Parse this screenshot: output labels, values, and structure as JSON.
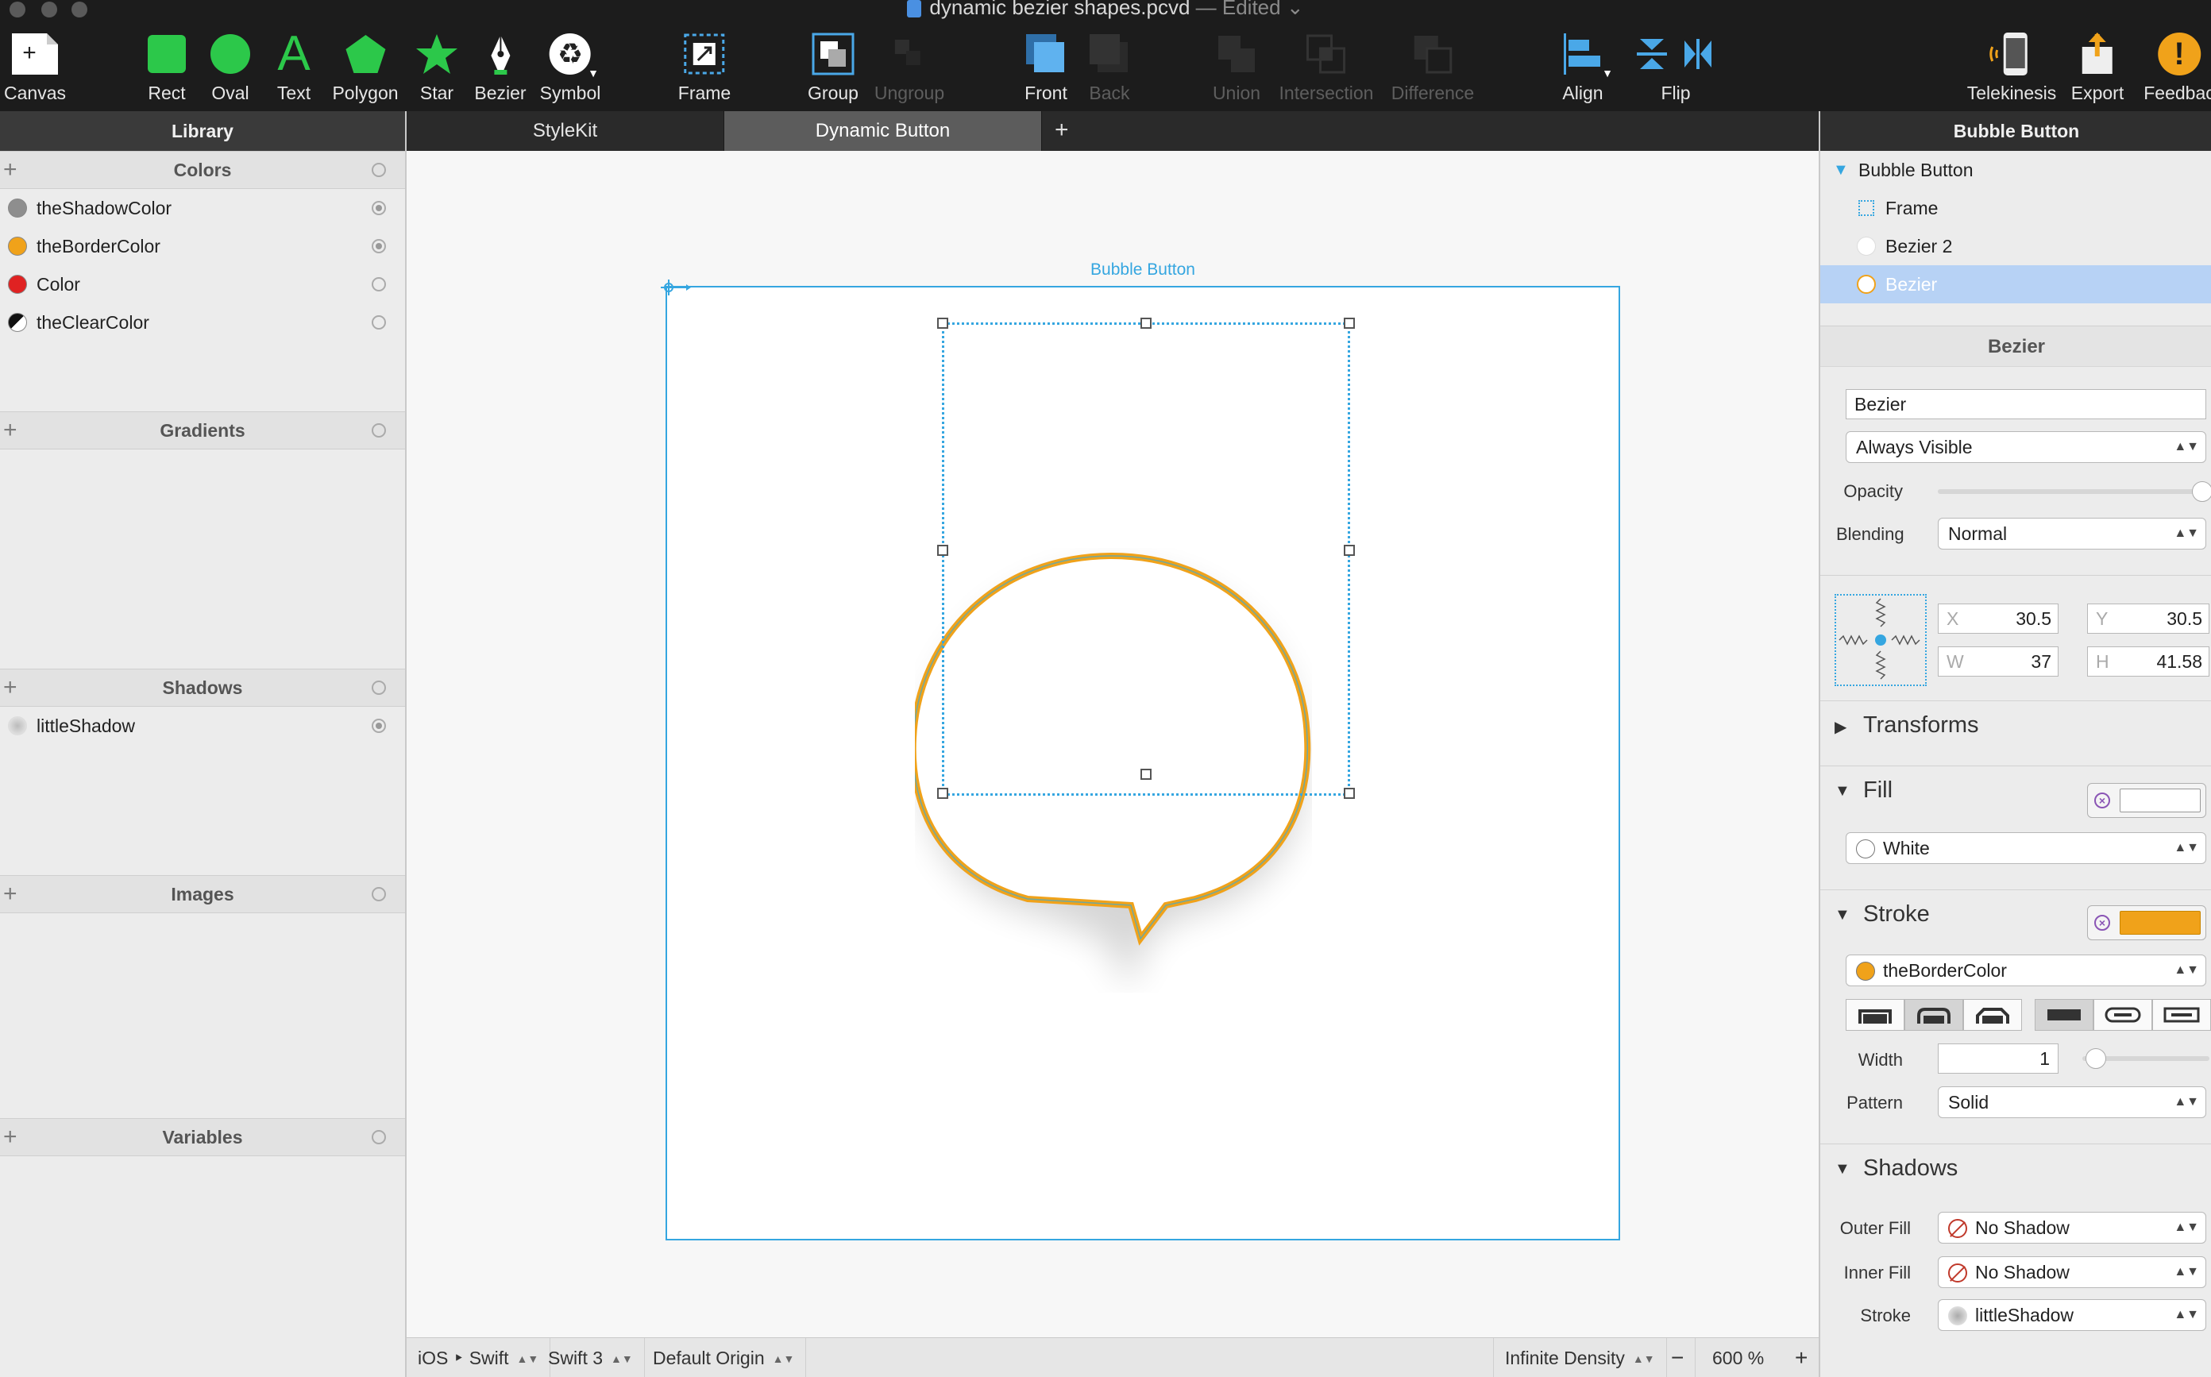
{
  "window": {
    "doc_name": "dynamic bezier shapes.pcvd",
    "edited": "— Edited"
  },
  "toolbar": {
    "canvas": "Canvas",
    "rect": "Rect",
    "oval": "Oval",
    "text": "Text",
    "polygon": "Polygon",
    "star": "Star",
    "bezier": "Bezier",
    "symbol": "Symbol",
    "frame": "Frame",
    "group": "Group",
    "ungroup": "Ungroup",
    "front": "Front",
    "back": "Back",
    "union": "Union",
    "intersection": "Intersection",
    "difference": "Difference",
    "align": "Align",
    "flip": "Flip",
    "telekinesis": "Telekinesis",
    "export": "Export",
    "feedback": "Feedbac",
    "accent_green": "#2cc84a",
    "accent_blue": "#4aa8e8",
    "accent_orange": "#f0a21a"
  },
  "library": {
    "header": "Library",
    "colors_title": "Colors",
    "colors": [
      {
        "name": "theShadowColor",
        "swatch": "#8e8e8e"
      },
      {
        "name": "theBorderColor",
        "swatch": "#f0a21a"
      },
      {
        "name": "Color",
        "swatch": "#e02222"
      },
      {
        "name": "theClearColor",
        "swatch": "half"
      }
    ],
    "gradients_title": "Gradients",
    "shadows_title": "Shadows",
    "shadows": [
      {
        "name": "littleShadow"
      }
    ],
    "images_title": "Images",
    "variables_title": "Variables"
  },
  "tabs": {
    "stylekit": "StyleKit",
    "dynamic_button": "Dynamic Button",
    "add": "+"
  },
  "canvas": {
    "artboard_label": "Bubble Button",
    "selection_color": "#35a6e0",
    "bubble_stroke": "#f0a21a"
  },
  "bottombar": {
    "platform": "iOS ‣ Swift",
    "swift_version": "Swift 3",
    "origin": "Default Origin",
    "density": "Infinite Density",
    "zoom_minus": "−",
    "zoom": "600 %",
    "zoom_plus": "+"
  },
  "inspector": {
    "header": "Bubble Button",
    "tree": [
      {
        "label": "Bubble Button"
      },
      {
        "label": "Frame"
      },
      {
        "label": "Bezier 2"
      },
      {
        "label": "Bezier"
      }
    ],
    "section_title": "Bezier",
    "name_value": "Bezier",
    "visibility": "Always Visible",
    "opacity_label": "Opacity",
    "opacity_value": 1.0,
    "blending_label": "Blending",
    "blending": "Normal",
    "x_label": "X",
    "x": "30.5",
    "y_label": "Y",
    "y": "30.5",
    "w_label": "W",
    "w": "37",
    "h_label": "H",
    "h": "41.58",
    "transforms": "Transforms",
    "fill": "Fill",
    "fill_value": "White",
    "fill_color": "#ffffff",
    "stroke": "Stroke",
    "stroke_value": "theBorderColor",
    "stroke_color": "#f0a21a",
    "width_label": "Width",
    "width_value": "1",
    "pattern_label": "Pattern",
    "pattern_value": "Solid",
    "shadows": "Shadows",
    "outer_fill_label": "Outer Fill",
    "outer_fill_value": "No Shadow",
    "inner_fill_label": "Inner Fill",
    "inner_fill_value": "No Shadow",
    "stroke_shadow_label": "Stroke",
    "stroke_shadow_value": "littleShadow"
  }
}
